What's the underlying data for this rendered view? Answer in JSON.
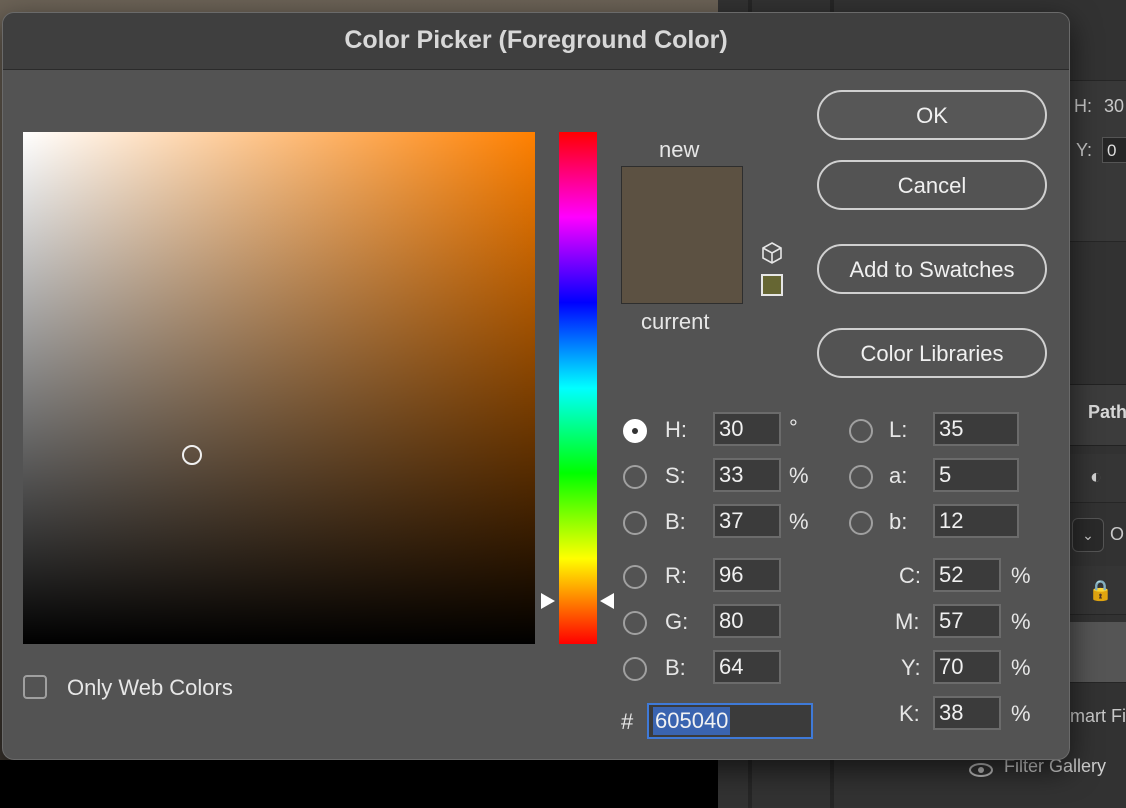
{
  "background_app": {
    "h_label": "H:",
    "h_value": "30",
    "y_label": "Y:",
    "y_value": "0",
    "paths_tab": "Path",
    "smart_filters": "mart Fi",
    "filter_gallery": "Filter Gallery",
    "dropdown_value": "O"
  },
  "dialog": {
    "title": "Color Picker (Foreground Color)"
  },
  "picker": {
    "hue_degrees": 30,
    "saturation_fraction": 0.33,
    "brightness_fraction": 0.37,
    "hue_field_color": "#ff8000"
  },
  "preview": {
    "new_label": "new",
    "current_label": "current",
    "new_color": "#5c5142",
    "current_color": "#5c5142",
    "websafe_color": "#666633"
  },
  "buttons": {
    "ok": "OK",
    "cancel": "Cancel",
    "add_to_swatches": "Add to Swatches",
    "color_libraries": "Color Libraries"
  },
  "hsb": {
    "h_label": "H:",
    "h_value": "30",
    "h_unit": "°",
    "s_label": "S:",
    "s_value": "33",
    "s_unit": "%",
    "b_label": "B:",
    "b_value": "37",
    "b_unit": "%",
    "selected": "H"
  },
  "lab": {
    "l_label": "L:",
    "l_value": "35",
    "a_label": "a:",
    "a_value": "5",
    "b_label": "b:",
    "b_value": "12"
  },
  "rgb": {
    "r_label": "R:",
    "r_value": "96",
    "g_label": "G:",
    "g_value": "80",
    "b_label": "B:",
    "b_value": "64"
  },
  "cmyk": {
    "c_label": "C:",
    "c_value": "52",
    "c_unit": "%",
    "m_label": "M:",
    "m_value": "57",
    "m_unit": "%",
    "y_label": "Y:",
    "y_value": "70",
    "y_unit": "%",
    "k_label": "K:",
    "k_value": "38",
    "k_unit": "%"
  },
  "hex": {
    "label": "#",
    "value": "605040"
  },
  "web_colors": {
    "label": "Only Web Colors",
    "checked": false
  }
}
